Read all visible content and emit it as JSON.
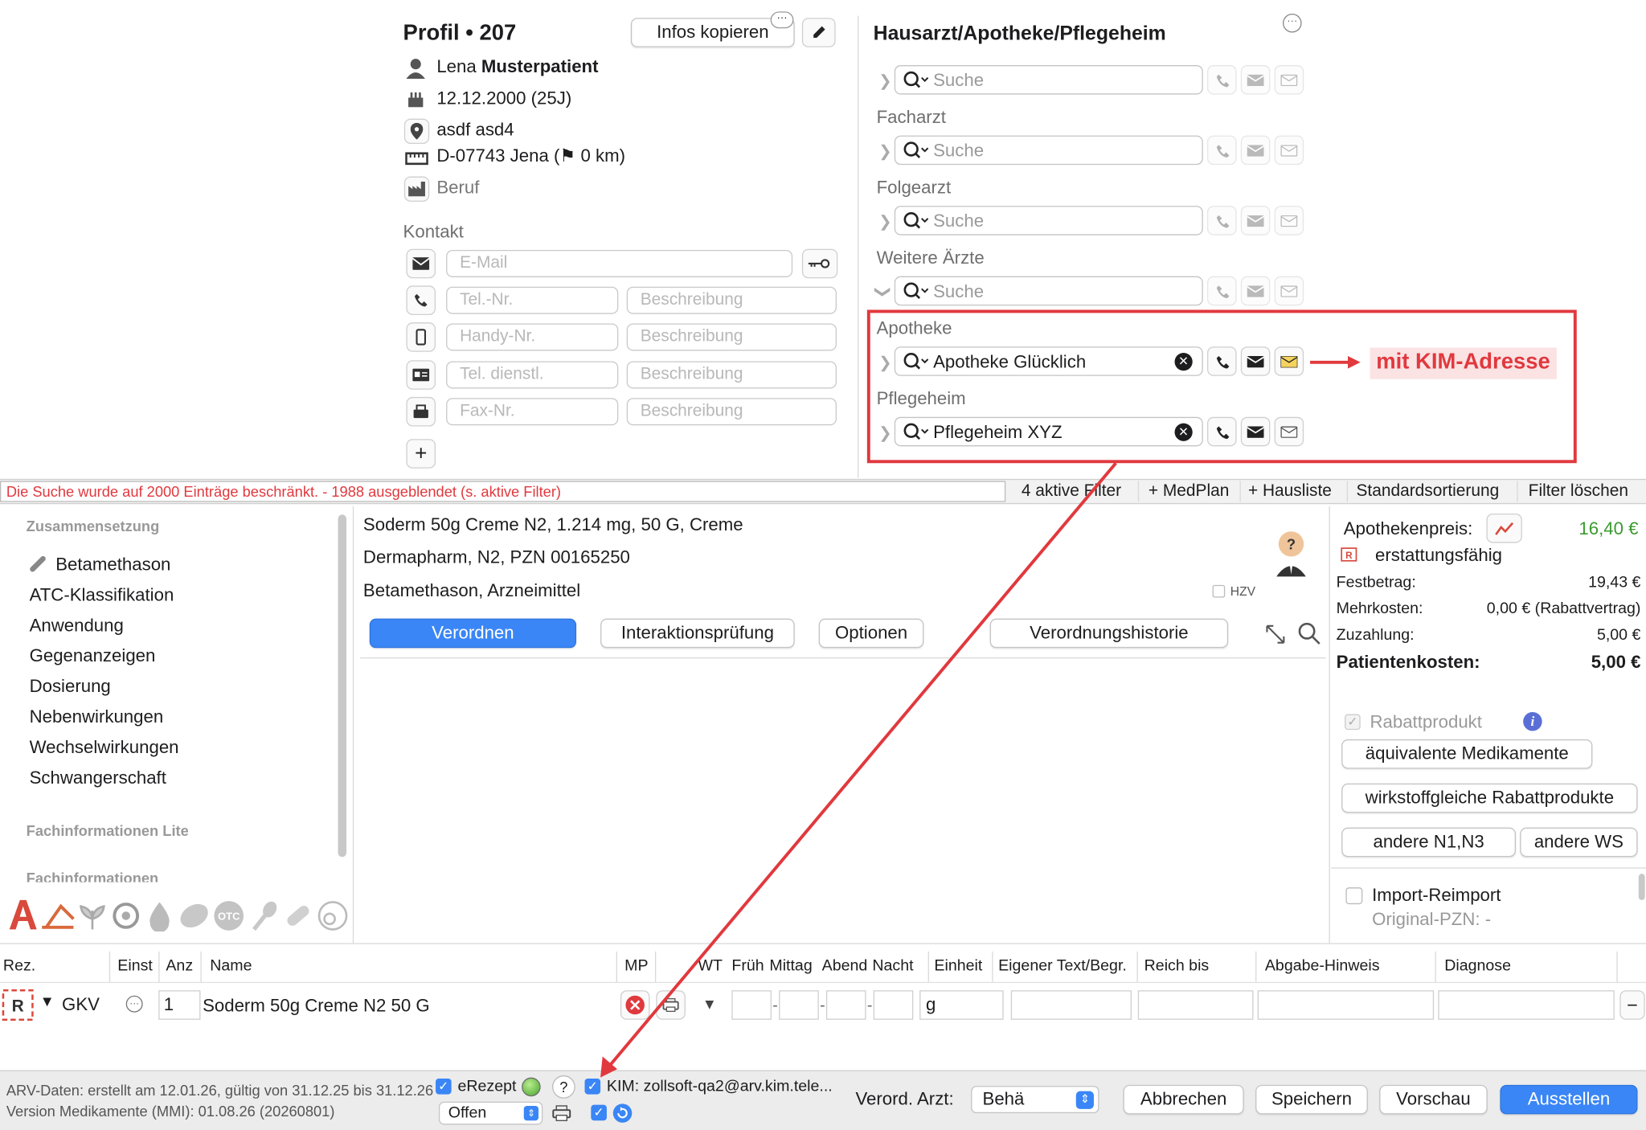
{
  "profile": {
    "title": "Profil",
    "number": "207",
    "copy_button": "Infos kopieren",
    "first_name": "Lena",
    "last_name": "Musterpatient",
    "birth": "12.12.2000 (25J)",
    "street": "asdf asd4",
    "city": "D-07743 Jena (⚑ 0 km)",
    "job": "Beruf",
    "contact_title": "Kontakt",
    "email_ph": "E-Mail",
    "tel_ph": "Tel.-Nr.",
    "mobile_ph": "Handy-Nr.",
    "work_ph": "Tel. dienstl.",
    "fax_ph": "Fax-Nr.",
    "desc_ph": "Beschreibung"
  },
  "doctors": {
    "title": "Hausarzt/Apotheke/Pflegeheim",
    "search_ph": "Suche",
    "facharzt": "Facharzt",
    "folgearzt": "Folgearzt",
    "weitere": "Weitere Ärzte",
    "apotheke": "Apotheke",
    "apotheke_value": "Apotheke Glücklich",
    "pflegeheim": "Pflegeheim",
    "pflegeheim_value": "Pflegeheim XYZ",
    "annotation": "mit KIM-Adresse",
    "annotation_color": "#e0393e"
  },
  "filterbar": {
    "warning": "Die Suche wurde auf 2000 Einträge beschränkt. - 1988 ausgeblendet (s. aktive Filter)",
    "active_filters": "4 aktive Filter",
    "medplan": "+ MedPlan",
    "hausliste": "+ Hausliste",
    "sort": "Standardsortierung",
    "clear": "Filter löschen"
  },
  "sidebar": {
    "section1": "Zusammensetzung",
    "items": [
      "Betamethason",
      "ATC-Klassifikation",
      "Anwendung",
      "Gegenanzeigen",
      "Dosierung",
      "Nebenwirkungen",
      "Wechselwirkungen",
      "Schwangerschaft"
    ],
    "section2": "Fachinformationen Lite",
    "section3": "Fachinformationen"
  },
  "drug": {
    "line1": "Soderm 50g Creme N2, 1.214 mg, 50 G, Creme",
    "line2": "Dermapharm, N2, PZN 00165250",
    "line3": "Betamethason, Arzneimittel",
    "hzv": "HZV",
    "tabs": [
      "Verordnen",
      "Interaktionsprüfung",
      "Optionen",
      "Verordnungshistorie"
    ]
  },
  "price": {
    "label": "Apothekenpreis:",
    "value": "16,40 €",
    "value_color": "#3a9a2e",
    "erstattung": "erstattungsfähig",
    "festbetrag_l": "Festbetrag:",
    "festbetrag_v": "19,43 €",
    "mehrkosten_l": "Mehrkosten:",
    "mehrkosten_v": "0,00 € (Rabattvertrag)",
    "zuzahlung_l": "Zuzahlung:",
    "zuzahlung_v": "5,00 €",
    "patient_l": "Patientenkosten:",
    "patient_v": "5,00 €",
    "rabatt": "Rabattprodukt",
    "aequiv": "äquivalente Medikamente",
    "wirkstoff": "wirkstoffgleiche Rabattprodukte",
    "n1n3": "andere N1,N3",
    "ws": "andere WS",
    "import": "Import-Reimport",
    "orig_pzn": "Original-PZN: -"
  },
  "table": {
    "headers": [
      "Rez.",
      "Einst",
      "Anz",
      "Name",
      "MP",
      "WT",
      "Früh",
      "Mittag",
      "Abend",
      "Nacht",
      "Einheit",
      "Eigener Text/Begr.",
      "Reich bis",
      "Abgabe-Hinweis",
      "Diagnose"
    ],
    "row": {
      "type": "GKV",
      "qty": "1",
      "name": "Soderm 50g Creme N2 50 G",
      "unit": "g"
    }
  },
  "footer": {
    "arv": "ARV-Daten: erstellt am 12.01.26, gültig von 31.12.25 bis 31.12.26",
    "version": "Version Medikamente (MMI):  01.08.26 (20260801)",
    "erezept": "eRezept",
    "kim": "KIM: zollsoft-qa2@arv.kim.tele...",
    "status": "Offen",
    "arzt_label": "Verord. Arzt:",
    "arzt": "Behä",
    "cancel": "Abbrechen",
    "save": "Speichern",
    "preview": "Vorschau",
    "issue": "Ausstellen",
    "accent": "#3a86f6"
  }
}
